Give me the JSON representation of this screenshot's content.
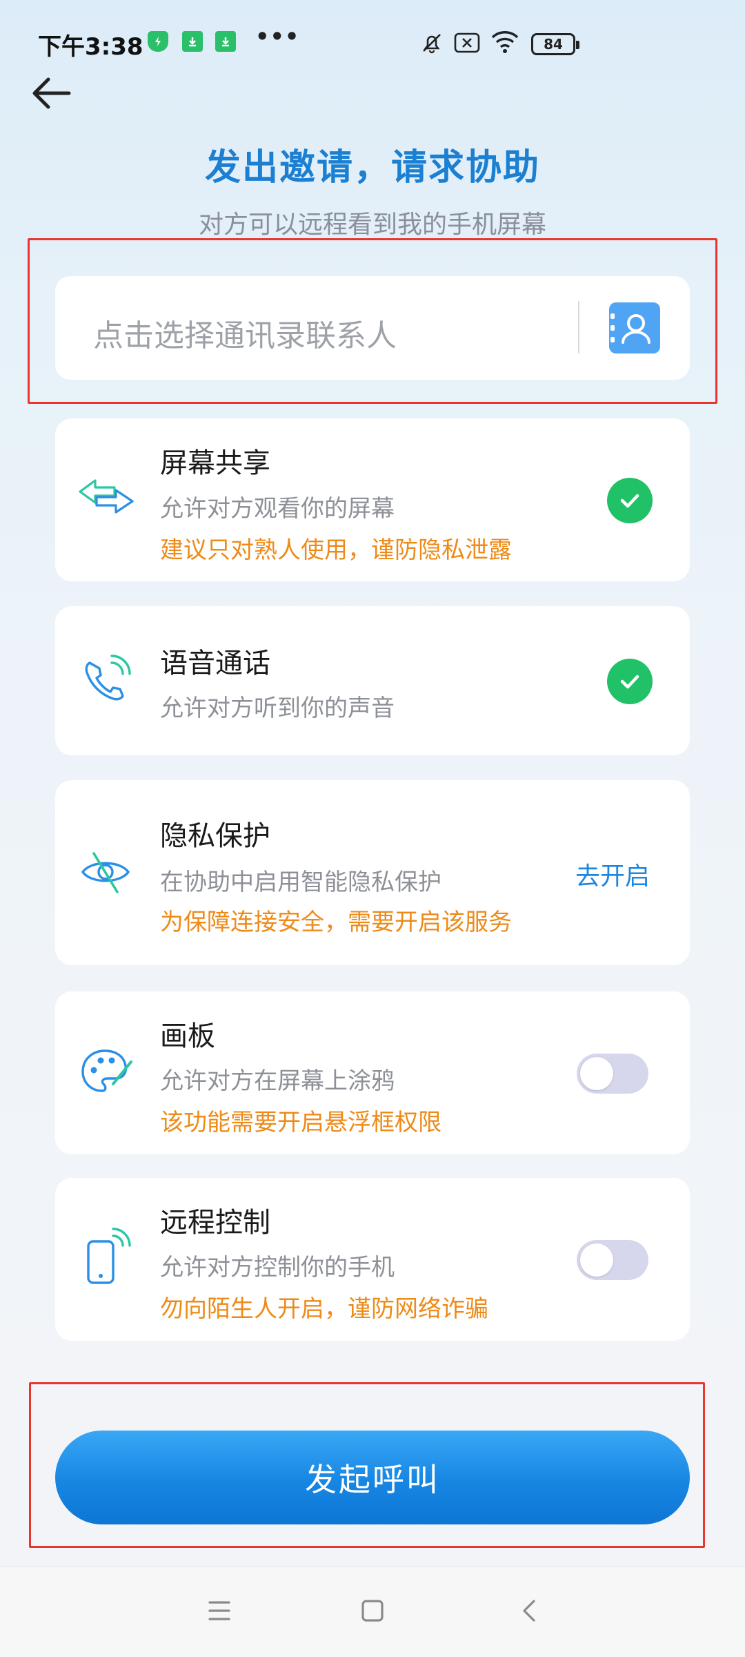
{
  "status_bar": {
    "time": "下午3:38",
    "more": "•••",
    "battery": "84",
    "icons": [
      "shield-icon",
      "download-icon",
      "download-icon",
      "mute-bell-icon",
      "sim-off-icon",
      "wifi-icon",
      "battery-icon"
    ]
  },
  "header": {
    "back_icon": "arrow-left-icon",
    "title": "发出邀请，请求协助",
    "subtitle": "对方可以远程看到我的手机屏幕"
  },
  "contact": {
    "placeholder": "点击选择通讯录联系人",
    "icon": "contact-book-icon"
  },
  "options": [
    {
      "title": "屏幕共享",
      "desc": "允许对方观看你的屏幕",
      "warning": "建议只对熟人使用，谨防隐私泄露",
      "icon": "swap-arrows-icon",
      "state": "checked"
    },
    {
      "title": "语音通话",
      "desc": "允许对方听到你的声音",
      "icon": "phone-call-icon",
      "state": "checked"
    },
    {
      "title": "隐私保护",
      "desc": "在协助中启用智能隐私保护",
      "warning": "为保障连接安全，需要开启该服务",
      "icon": "eye-slash-icon",
      "action": "去开启"
    },
    {
      "title": "画板",
      "desc": "允许对方在屏幕上涂鸦",
      "warning": "该功能需要开启悬浮框权限",
      "icon": "palette-icon",
      "state": "off"
    },
    {
      "title": "远程控制",
      "desc": "允许对方控制你的手机",
      "warning": "勿向陌生人开启，谨防网络诈骗",
      "icon": "phone-signal-icon",
      "state": "off"
    }
  ],
  "call_button": "发起呼叫",
  "nav": {
    "icons": [
      "menu-icon",
      "home-square-icon",
      "back-chevron-icon"
    ]
  },
  "colors": {
    "accent": "#1b7fd2",
    "check_green": "#21c267",
    "warning_orange": "#ee8a17",
    "highlight_red": "#e8362f"
  }
}
